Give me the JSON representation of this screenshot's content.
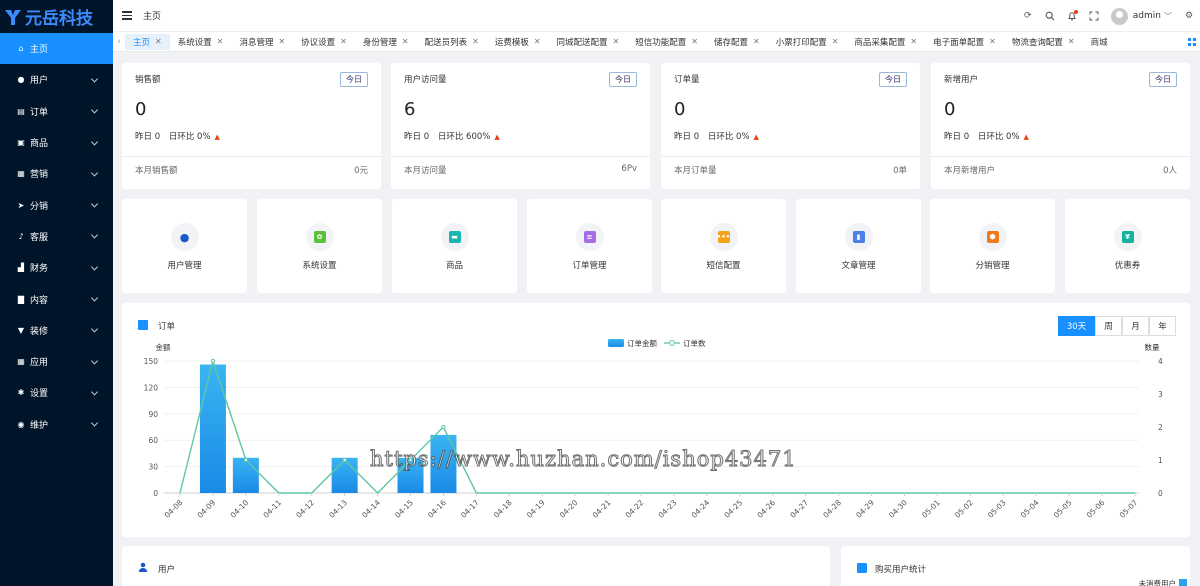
{
  "brand": {
    "name": "元岳科技"
  },
  "sidebar": {
    "items": [
      {
        "label": "主页",
        "icon": "home-icon",
        "active": true
      },
      {
        "label": "用户",
        "icon": "user-icon"
      },
      {
        "label": "订单",
        "icon": "order-icon"
      },
      {
        "label": "商品",
        "icon": "goods-icon"
      },
      {
        "label": "营销",
        "icon": "marketing-icon"
      },
      {
        "label": "分销",
        "icon": "send-icon"
      },
      {
        "label": "客服",
        "icon": "bell-icon"
      },
      {
        "label": "财务",
        "icon": "finance-icon"
      },
      {
        "label": "内容",
        "icon": "content-icon"
      },
      {
        "label": "装修",
        "icon": "decoration-icon"
      },
      {
        "label": "应用",
        "icon": "apps-icon"
      },
      {
        "label": "设置",
        "icon": "gear-icon"
      },
      {
        "label": "维护",
        "icon": "maintenance-icon"
      }
    ]
  },
  "header": {
    "breadcrumb": "主页",
    "username": "admin"
  },
  "tabs": [
    {
      "label": "主页",
      "active": true
    },
    {
      "label": "系统设置"
    },
    {
      "label": "消息管理"
    },
    {
      "label": "协议设置"
    },
    {
      "label": "身份管理"
    },
    {
      "label": "配送员列表"
    },
    {
      "label": "运费模板"
    },
    {
      "label": "同城配送配置"
    },
    {
      "label": "短信功能配置"
    },
    {
      "label": "储存配置"
    },
    {
      "label": "小票打印配置"
    },
    {
      "label": "商品采集配置"
    },
    {
      "label": "电子面单配置"
    },
    {
      "label": "物流查询配置"
    },
    {
      "label": "商城"
    }
  ],
  "stats": [
    {
      "title": "销售额",
      "badge": "今日",
      "value": "0",
      "yesterday": "昨日 0",
      "ratio": "日环比 0%",
      "foot_label": "本月销售额",
      "foot_value": "0元"
    },
    {
      "title": "用户访问量",
      "badge": "今日",
      "value": "6",
      "yesterday": "昨日 0",
      "ratio": "日环比 600%",
      "foot_label": "本月访问量",
      "foot_value": "6Pv"
    },
    {
      "title": "订单量",
      "badge": "今日",
      "value": "0",
      "yesterday": "昨日 0",
      "ratio": "日环比 0%",
      "foot_label": "本月订单量",
      "foot_value": "0单"
    },
    {
      "title": "新增用户",
      "badge": "今日",
      "value": "0",
      "yesterday": "昨日 0",
      "ratio": "日环比 0%",
      "foot_label": "本月新增用户",
      "foot_value": "0人"
    }
  ],
  "quick": [
    {
      "label": "用户管理",
      "icon": "user-manage-icon",
      "color": "#1a57c9",
      "glyph": "●"
    },
    {
      "label": "系统设置",
      "icon": "system-settings-icon",
      "color": "#5cc13a",
      "glyph": "✿"
    },
    {
      "label": "商品",
      "icon": "goods-icon",
      "color": "#1ab6b0",
      "glyph": "▬"
    },
    {
      "label": "订单管理",
      "icon": "order-manage-icon",
      "color": "#a56ee6",
      "glyph": "≡"
    },
    {
      "label": "短信配置",
      "icon": "sms-icon",
      "color": "#f2a31b",
      "glyph": "•••"
    },
    {
      "label": "文章管理",
      "icon": "article-icon",
      "color": "#4f7fe8",
      "glyph": "▮"
    },
    {
      "label": "分销管理",
      "icon": "distribution-icon",
      "color": "#f07a1a",
      "glyph": "⬢"
    },
    {
      "label": "优惠券",
      "icon": "coupon-icon",
      "color": "#16b39b",
      "glyph": "¥"
    }
  ],
  "order_panel": {
    "title": "订单",
    "periods": [
      "30天",
      "周",
      "月",
      "年"
    ],
    "active_period": "30天"
  },
  "chart_data": {
    "type": "bar",
    "title": "",
    "x": [
      "04-08",
      "04-09",
      "04-10",
      "04-11",
      "04-12",
      "04-13",
      "04-14",
      "04-15",
      "04-16",
      "04-17",
      "04-18",
      "04-19",
      "04-20",
      "04-21",
      "04-22",
      "04-23",
      "04-24",
      "04-25",
      "04-26",
      "04-27",
      "04-28",
      "04-29",
      "04-30",
      "05-01",
      "05-02",
      "05-03",
      "05-04",
      "05-05",
      "05-06",
      "05-07"
    ],
    "series": [
      {
        "name": "订单金额",
        "type": "bar",
        "axis": "left",
        "color": "#2a9ff0",
        "values": [
          0,
          146,
          40,
          0,
          0,
          40,
          0,
          40,
          66,
          0,
          0,
          0,
          0,
          0,
          0,
          0,
          0,
          0,
          0,
          0,
          0,
          0,
          0,
          0,
          0,
          0,
          0,
          0,
          0,
          0
        ]
      },
      {
        "name": "订单数",
        "type": "line",
        "axis": "right",
        "color": "#5ec7a4",
        "values": [
          0,
          4,
          1,
          0,
          0,
          1,
          0,
          1,
          2,
          0,
          0,
          0,
          0,
          0,
          0,
          0,
          0,
          0,
          0,
          0,
          0,
          0,
          0,
          0,
          0,
          0,
          0,
          0,
          0,
          0
        ]
      }
    ],
    "ylabel_left": "金额",
    "ylabel_right": "数量",
    "yleft_ticks": [
      0,
      30,
      60,
      90,
      120,
      150
    ],
    "yright_ticks": [
      0,
      1,
      2,
      3,
      4
    ],
    "ylim_left": [
      0,
      150
    ],
    "ylim_right": [
      0,
      4
    ],
    "legend": "top-center",
    "grid": true
  },
  "user_panel": {
    "title": "用户"
  },
  "buy_panel": {
    "title": "购买用户统计",
    "legend": "未消费用户"
  },
  "watermark": "https://www.huzhan.com/ishop43471"
}
